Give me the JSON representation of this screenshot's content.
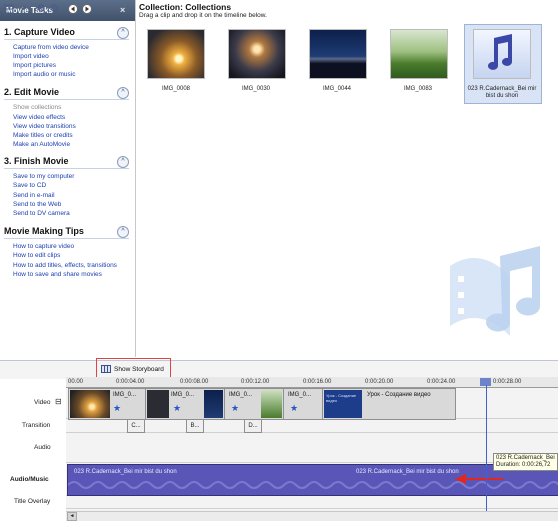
{
  "taskpane": {
    "header": "Movie Tasks",
    "close_glyph": "×",
    "sections": [
      {
        "number": "1.",
        "title": "Capture Video",
        "toggle": "^",
        "links": [
          "Capture from video device",
          "Import video",
          "Import pictures",
          "Import audio or music"
        ]
      },
      {
        "number": "2.",
        "title": "Edit Movie",
        "toggle": "^",
        "links": [
          "Show collections",
          "View video effects",
          "View video transitions",
          "Make titles or credits",
          "Make an AutoMovie"
        ]
      },
      {
        "number": "3.",
        "title": "Finish Movie",
        "toggle": "^",
        "links": [
          "Save to my computer",
          "Save to CD",
          "Send in e-mail",
          "Send to the Web",
          "Send to DV camera"
        ]
      }
    ],
    "tips": {
      "title": "Movie Making Tips",
      "toggle": "^",
      "links": [
        "How to capture video",
        "How to edit clips",
        "How to add titles, effects, transitions",
        "How to save and share movies"
      ]
    }
  },
  "collection": {
    "title": "Collection: Collections",
    "subtitle": "Drag a clip and drop it on the timeline below.",
    "items": [
      {
        "caption": "IMG_0008"
      },
      {
        "caption": "IMG_0030"
      },
      {
        "caption": "IMG_0044"
      },
      {
        "caption": "IMG_0083"
      },
      {
        "caption": "023 R.Cadernack_Bei mir bist du shon"
      }
    ]
  },
  "timeline": {
    "storyboard_label": "Show Storyboard",
    "ruler": [
      "00.00",
      "0:00:04.00",
      "0:00:08.00",
      "0:00:12.00",
      "0:00:16.00",
      "0:00:20.00",
      "0:00:24.00",
      "0:00:28.00"
    ],
    "tracks": [
      "Video",
      "Transition",
      "Audio",
      "Audio/Music",
      "Title Overlay"
    ],
    "video_clips": [
      "IMG_0...",
      "IMG_0...",
      "IMG_0...",
      "IMG_0...",
      "Урок - Создание видео"
    ],
    "title_card_text": "Урок - Создание видео",
    "transitions": [
      "C...",
      "B...",
      "D..."
    ],
    "audio_clip": "023 R.Cadernack_Bei mir bist du shon",
    "audio_clip_repeat": "023 R.Cadernack_Bei mir bist du shon",
    "tooltip_title": "023 R.Cadernack_Bei",
    "tooltip_duration": "Duration: 0:00:26,72",
    "expand_glyph": "⊟"
  }
}
